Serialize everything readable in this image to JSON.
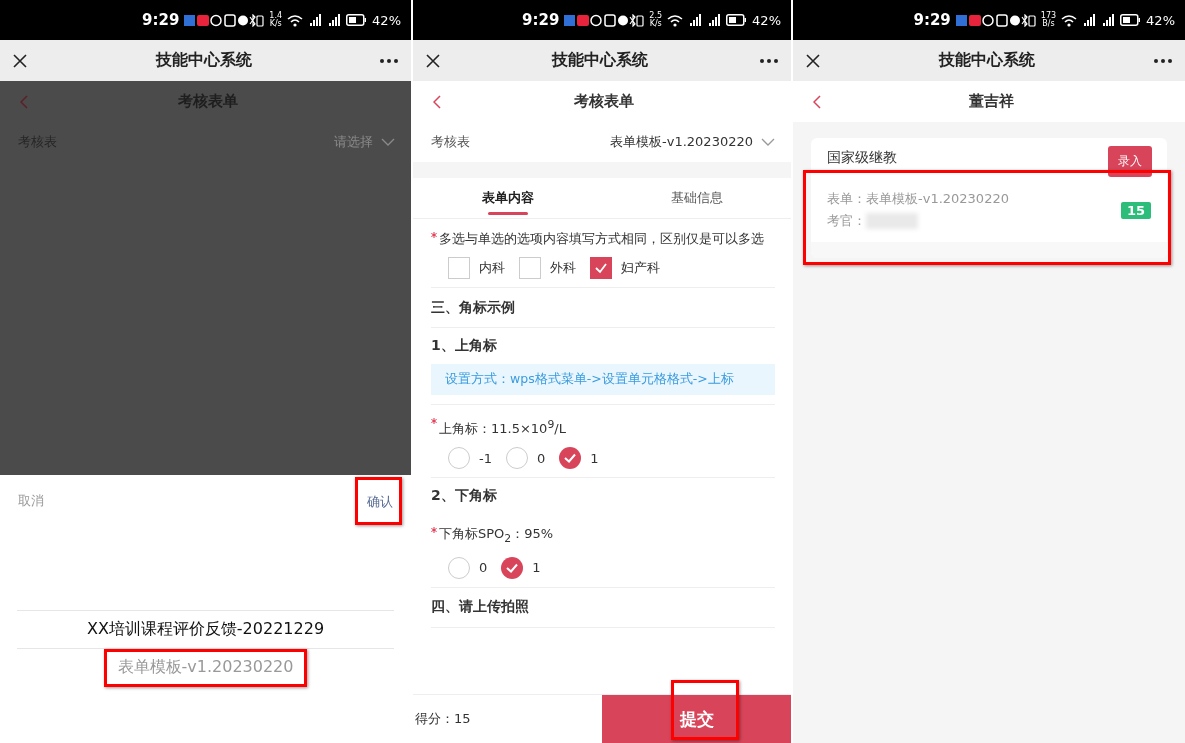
{
  "screens": [
    {
      "kind": "picker",
      "dimmed": true,
      "status_bar": {
        "time": "9:29",
        "speed": "1.4",
        "speed_unit": "K/s",
        "battery": "42%"
      },
      "app_bar": {
        "title": "技能中心系统"
      },
      "header": {
        "title": "考核表单"
      },
      "field": {
        "label": "考核表",
        "placeholder": "请选择"
      },
      "sheet": {
        "cancel": "取消",
        "confirm": {
          "label": "确认",
          "highlighted": true
        },
        "options": [
          {
            "label": "XX培训课程评价反馈-20221229",
            "selected": true,
            "highlighted": false
          },
          {
            "label": "表单模板-v1.20230220",
            "selected": false,
            "highlighted": true
          }
        ]
      }
    },
    {
      "kind": "form",
      "status_bar": {
        "time": "9:29",
        "speed": "2.5",
        "speed_unit": "K/s",
        "battery": "42%"
      },
      "app_bar": {
        "title": "技能中心系统"
      },
      "header": {
        "title": "考核表单"
      },
      "field": {
        "label": "考核表",
        "value": "表单模板-v1.20230220"
      },
      "tabs": [
        {
          "label": "表单内容",
          "selected": true
        },
        {
          "label": "基础信息",
          "selected": false
        }
      ],
      "items": [
        {
          "kind": "checkbox",
          "required": true,
          "text": "多选与单选的选项内容填写方式相同，区别仅是可以多选",
          "options": [
            {
              "label": "内科",
              "checked": false
            },
            {
              "label": "外科",
              "checked": false
            },
            {
              "label": "妇产科",
              "checked": true
            }
          ]
        },
        {
          "kind": "section",
          "text": "三、角标示例"
        },
        {
          "kind": "subsection",
          "text": "1、上角标"
        },
        {
          "kind": "note",
          "text": "设置方式：wps格式菜单->设置单元格格式->上标"
        },
        {
          "kind": "radio",
          "required": true,
          "text": "上角标：11.5×10$^{9}$/L",
          "options": [
            {
              "label": "-1",
              "selected": false
            },
            {
              "label": "0",
              "selected": false
            },
            {
              "label": "1",
              "selected": true
            }
          ]
        },
        {
          "kind": "subsection",
          "text": "2、下角标"
        },
        {
          "kind": "radio",
          "required": true,
          "text": "下角标SPO$_{2}$：95%",
          "options": [
            {
              "label": "0",
              "selected": false
            },
            {
              "label": "1",
              "selected": true
            }
          ]
        },
        {
          "kind": "section",
          "text": "四、请上传拍照"
        }
      ],
      "footer": {
        "score": "得分：15",
        "submit": {
          "label": "提交",
          "highlighted": true
        }
      }
    },
    {
      "kind": "record",
      "status_bar": {
        "time": "9:29",
        "speed": "173",
        "speed_unit": "B/s",
        "battery": "42%"
      },
      "app_bar": {
        "title": "技能中心系统"
      },
      "header": {
        "title": "董吉祥"
      },
      "card": {
        "title": "国家级继教",
        "button": "录入",
        "records": [
          {
            "form": "表单：表单模板-v1.20230220",
            "examiner": "考官：",
            "name_blurred": true,
            "score": "15",
            "highlighted": true
          }
        ]
      }
    }
  ]
}
